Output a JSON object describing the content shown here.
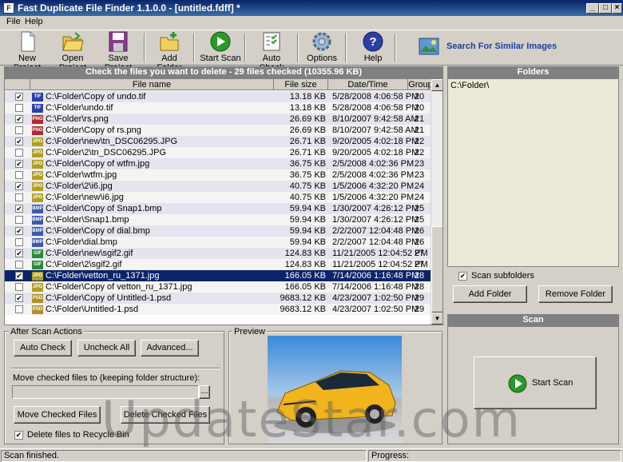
{
  "window": {
    "title": "Fast Duplicate File Finder 1.1.0.0 - [untitled.fdff] *"
  },
  "menu": [
    "File",
    "Help"
  ],
  "toolbar": {
    "new_project": "New Project",
    "open_project": "Open Project",
    "save_project": "Save Project",
    "add_folder": "Add Folder",
    "start_scan": "Start Scan",
    "auto_check": "Auto Check",
    "options": "Options",
    "help": "Help",
    "search_similar": "Search For Similar Images"
  },
  "results": {
    "header": "Check the files you want to delete - 29 files checked (10355.96 KB)",
    "columns": {
      "file_name": "File name",
      "file_size": "File size",
      "date_time": "Date/Time",
      "group": "Group"
    },
    "rows": [
      {
        "checked": true,
        "type": "TIF",
        "name": "C:\\Folder\\Copy of undo.tif",
        "size": "13.18 KB",
        "date": "5/28/2008 4:06:58 PM",
        "group": "20"
      },
      {
        "checked": false,
        "type": "TIF",
        "name": "C:\\Folder\\undo.tif",
        "size": "13.18 KB",
        "date": "5/28/2008 4:06:58 PM",
        "group": "20"
      },
      {
        "checked": true,
        "type": "PNG",
        "name": "C:\\Folder\\rs.png",
        "size": "26.69 KB",
        "date": "8/10/2007 9:42:58 AM",
        "group": "21"
      },
      {
        "checked": false,
        "type": "PNG",
        "name": "C:\\Folder\\Copy of rs.png",
        "size": "26.69 KB",
        "date": "8/10/2007 9:42:58 AM",
        "group": "21"
      },
      {
        "checked": true,
        "type": "JPG",
        "name": "C:\\Folder\\new\\tn_DSC06295.JPG",
        "size": "26.71 KB",
        "date": "9/20/2005 4:02:18 PM",
        "group": "22"
      },
      {
        "checked": false,
        "type": "JPG",
        "name": "C:\\Folder\\2\\tn_DSC06295.JPG",
        "size": "26.71 KB",
        "date": "9/20/2005 4:02:18 PM",
        "group": "22"
      },
      {
        "checked": true,
        "type": "JPG",
        "name": "C:\\Folder\\Copy of wtfm.jpg",
        "size": "36.75 KB",
        "date": "2/5/2008 4:02:36 PM",
        "group": "23"
      },
      {
        "checked": false,
        "type": "JPG",
        "name": "C:\\Folder\\wtfm.jpg",
        "size": "36.75 KB",
        "date": "2/5/2008 4:02:36 PM",
        "group": "23"
      },
      {
        "checked": true,
        "type": "JPG",
        "name": "C:\\Folder\\2\\i6.jpg",
        "size": "40.75 KB",
        "date": "1/5/2006 4:32:20 PM",
        "group": "24"
      },
      {
        "checked": false,
        "type": "JPG",
        "name": "C:\\Folder\\new\\i6.jpg",
        "size": "40.75 KB",
        "date": "1/5/2006 4:32:20 PM",
        "group": "24"
      },
      {
        "checked": true,
        "type": "BMP",
        "name": "C:\\Folder\\Copy of Snap1.bmp",
        "size": "59.94 KB",
        "date": "1/30/2007 4:26:12 PM",
        "group": "25"
      },
      {
        "checked": false,
        "type": "BMP",
        "name": "C:\\Folder\\Snap1.bmp",
        "size": "59.94 KB",
        "date": "1/30/2007 4:26:12 PM",
        "group": "25"
      },
      {
        "checked": true,
        "type": "BMP",
        "name": "C:\\Folder\\Copy of dial.bmp",
        "size": "59.94 KB",
        "date": "2/2/2007 12:04:48 PM",
        "group": "26"
      },
      {
        "checked": false,
        "type": "BMP",
        "name": "C:\\Folder\\dial.bmp",
        "size": "59.94 KB",
        "date": "2/2/2007 12:04:48 PM",
        "group": "26"
      },
      {
        "checked": true,
        "type": "GIF",
        "name": "C:\\Folder\\new\\sgif2.gif",
        "size": "124.83 KB",
        "date": "11/21/2005 12:04:52 PM",
        "group": "27"
      },
      {
        "checked": false,
        "type": "GIF",
        "name": "C:\\Folder\\2\\sgif2.gif",
        "size": "124.83 KB",
        "date": "11/21/2005 12:04:52 PM",
        "group": "27"
      },
      {
        "checked": true,
        "type": "JPG",
        "name": "C:\\Folder\\vetton_ru_1371.jpg",
        "size": "166.05 KB",
        "date": "7/14/2006 1:16:48 PM",
        "group": "28",
        "selected": true
      },
      {
        "checked": false,
        "type": "JPG",
        "name": "C:\\Folder\\Copy of vetton_ru_1371.jpg",
        "size": "166.05 KB",
        "date": "7/14/2006 1:16:48 PM",
        "group": "28"
      },
      {
        "checked": true,
        "type": "PSD",
        "name": "C:\\Folder\\Copy of Untitled-1.psd",
        "size": "9683.12 KB",
        "date": "4/23/2007 1:02:50 PM",
        "group": "29"
      },
      {
        "checked": false,
        "type": "PSD",
        "name": "C:\\Folder\\Untitled-1.psd",
        "size": "9683.12 KB",
        "date": "4/23/2007 1:02:50 PM",
        "group": "29"
      }
    ]
  },
  "folders": {
    "header": "Folders",
    "items": [
      "C:\\Folder\\"
    ],
    "scan_subfolders": "Scan subfolders",
    "add_folder": "Add Folder",
    "remove_folder": "Remove Folder"
  },
  "after_scan": {
    "legend": "After Scan Actions",
    "auto_check": "Auto Check",
    "uncheck_all": "Uncheck All",
    "advanced": "Advanced...",
    "move_label": "Move checked files to (keeping folder structure):",
    "browse": "...",
    "move_checked": "Move Checked Files",
    "delete_checked": "Delete Checked Files",
    "recycle_bin": "Delete files to Recycle Bin"
  },
  "preview": {
    "legend": "Preview"
  },
  "scan": {
    "header": "Scan",
    "start_scan": "Start Scan"
  },
  "status": {
    "text": "Scan finished.",
    "progress_label": "Progress:"
  },
  "watermark": "UpdateStar.com",
  "colors": {
    "title_bar": "#0a246a",
    "selection": "#0a246a",
    "header_bar": "#808080",
    "search_link": "#1c3fa0"
  }
}
